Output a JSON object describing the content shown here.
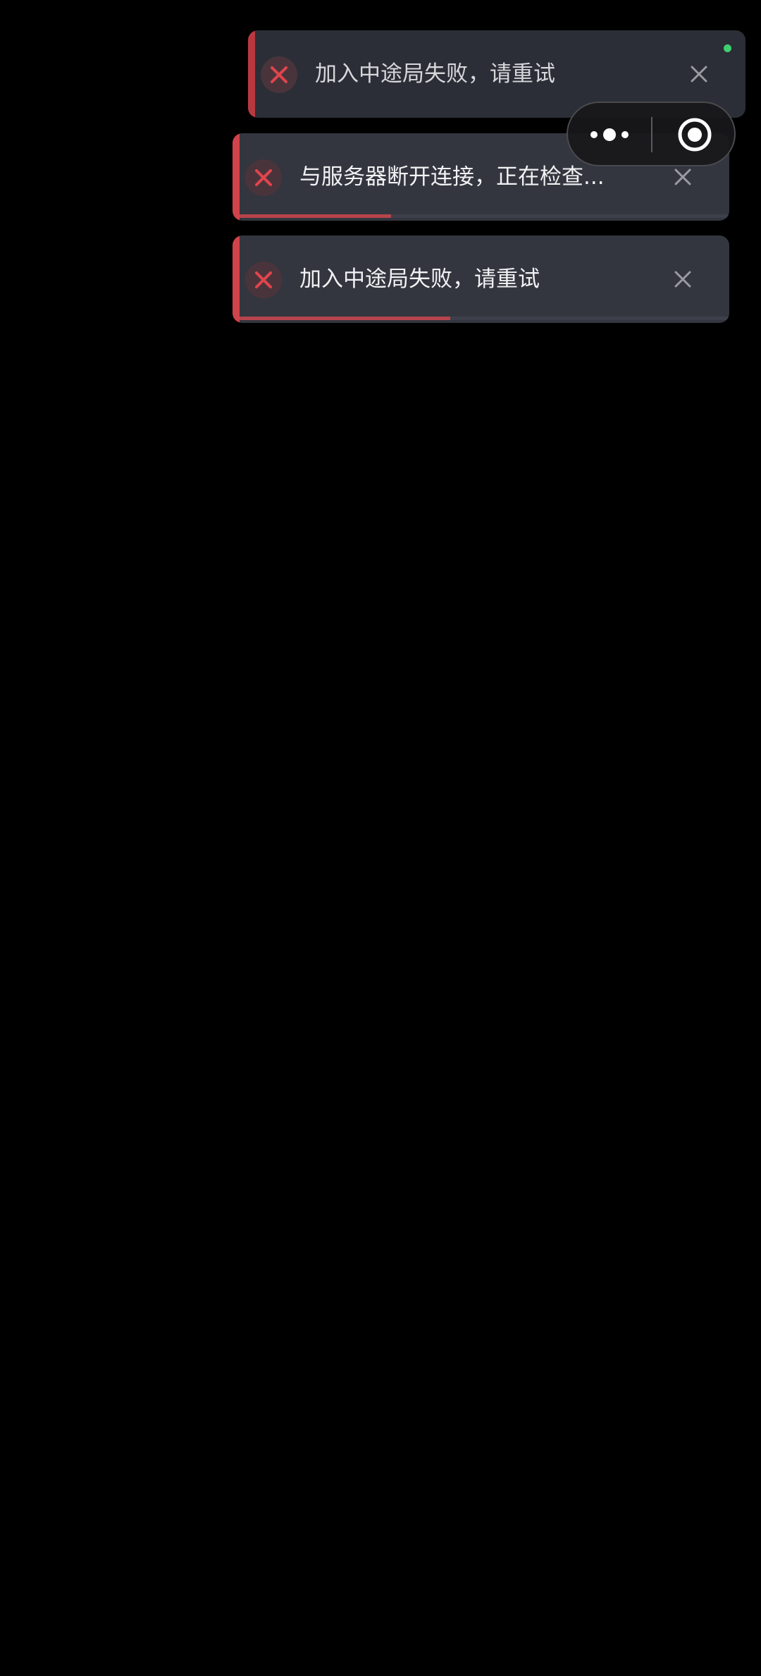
{
  "toasts": [
    {
      "message": "加入中途局失败，请重试",
      "progress": 0,
      "accent": "#b8383f"
    },
    {
      "message": "与服务器断开连接，正在检查...",
      "progress": 0.31,
      "accent": "#d1434b"
    },
    {
      "message": "加入中途局失败，请重试",
      "progress": 0.43,
      "accent": "#d1434b"
    }
  ],
  "icons": {
    "error": "x-circle-icon",
    "dismiss": "close-icon",
    "menu": "more-dots-icon",
    "exit": "target-circle-icon"
  },
  "colors": {
    "background": "#000000",
    "toast_bg": "#33363f",
    "error_red": "#d1434b",
    "status_green": "#3ecf6e"
  }
}
